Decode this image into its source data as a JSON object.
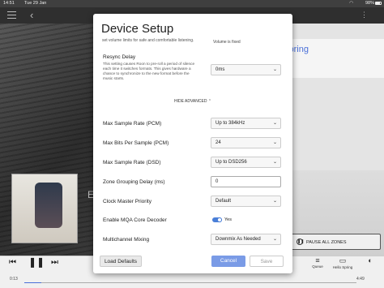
{
  "status_bar": {
    "time": "14:51",
    "date": "Tue 29 Jan",
    "battery": "98%"
  },
  "nav": {
    "back_glyph": "‹"
  },
  "right_panel": {
    "title": "o Spring",
    "subtitle": "oo",
    "pause_all": "PAUSE ALL ZONES"
  },
  "now_playing": {
    "partial_title": "E\nN",
    "time_elapsed": "0:13",
    "time_total": "4:49",
    "progress": 0.05
  },
  "bottom_icons": {
    "queue": "Queue",
    "zone": "Hello Spring"
  },
  "dialog": {
    "title": "Device Setup",
    "cut_text": "set volume limits for safe and comfortable listening.",
    "volume_note": "Volume is fixed",
    "resync": {
      "label": "Resync Delay",
      "description": "This setting causes Roon to pre-roll a period of silence each time it switches formats. This gives hardware a chance to synchronize to the new format before the music starts.",
      "value": "0ms"
    },
    "hide_advanced": "HIDE ADVANCED",
    "settings": [
      {
        "label": "Max Sample Rate (PCM)",
        "value": "Up to 384kHz"
      },
      {
        "label": "Max Bits Per Sample (PCM)",
        "value": "24"
      },
      {
        "label": "Max Sample Rate (DSD)",
        "value": "Up to DSD256"
      },
      {
        "label": "Zone Grouping Delay (ms)",
        "value": "0"
      },
      {
        "label": "Clock Master Priority",
        "value": "Default"
      },
      {
        "label": "Enable MQA Core Decoder",
        "value": "Yes"
      },
      {
        "label": "Multichannel Mixing",
        "value": "Downmix As Needed"
      }
    ],
    "buttons": {
      "load_defaults": "Load Defaults",
      "cancel": "Cancel",
      "save": "Save"
    }
  },
  "colors": {
    "accent": "#4a7fd8",
    "cancel_bg": "#7a9be6"
  }
}
